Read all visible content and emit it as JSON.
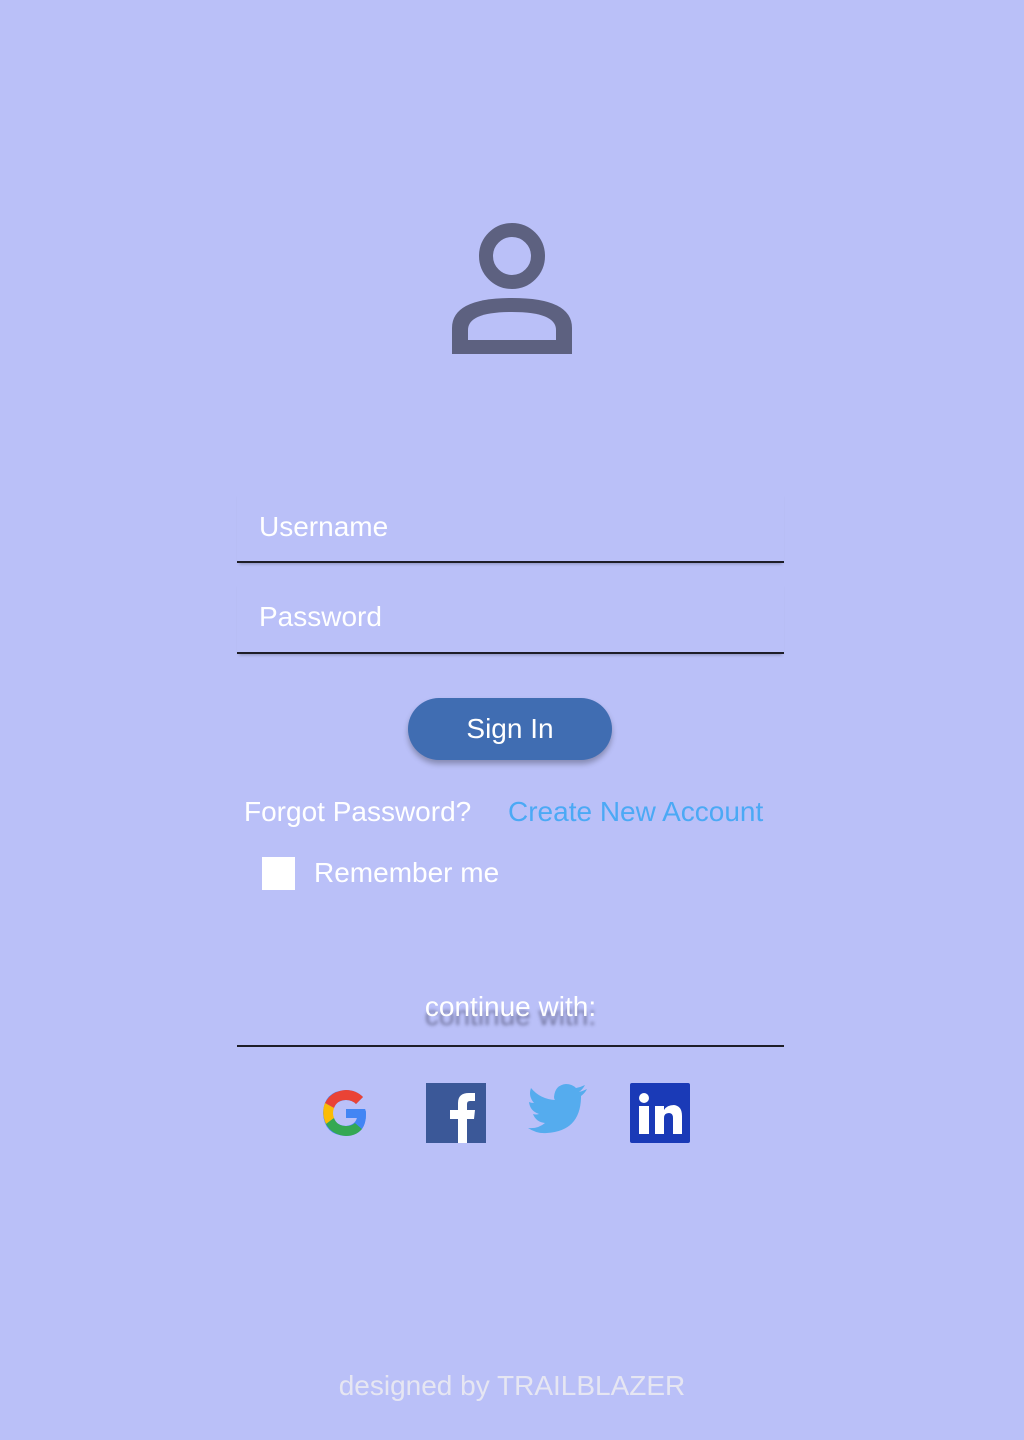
{
  "login": {
    "username_placeholder": "Username",
    "password_placeholder": "Password",
    "signin_label": "Sign In",
    "forgot_label": "Forgot Password?",
    "create_label": "Create New Account",
    "remember_label": "Remember me",
    "remember_checked": false
  },
  "social": {
    "heading": "continue with:",
    "providers": [
      {
        "name": "Google",
        "icon": "google-icon"
      },
      {
        "name": "Facebook",
        "icon": "facebook-icon",
        "color": "#3b5898"
      },
      {
        "name": "Twitter",
        "icon": "twitter-icon",
        "color": "#55acee"
      },
      {
        "name": "LinkedIn",
        "icon": "linkedin-icon",
        "color": "#1a3ab7"
      }
    ]
  },
  "footer": {
    "credit": "designed by TRAILBLAZER"
  },
  "colors": {
    "background": "#bac0f8",
    "button": "#406db2",
    "link": "#4ba9f5",
    "avatar": "#5d6180"
  }
}
